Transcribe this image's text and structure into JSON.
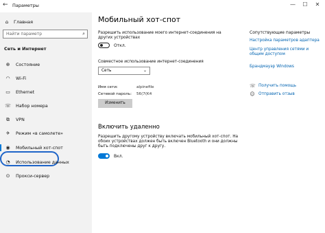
{
  "window": {
    "title": "Параметры",
    "back_icon": "back-arrow-icon",
    "minimize": "—",
    "maximize": "☐",
    "close": "✕"
  },
  "sidebar": {
    "home_label": "Главная",
    "search_placeholder": "Найти параметр",
    "section_title": "Сеть и Интернет",
    "items": [
      {
        "label": "Состояние",
        "icon": "status-icon",
        "glyph": "⊕"
      },
      {
        "label": "Wi-Fi",
        "icon": "wifi-icon",
        "glyph": "◠"
      },
      {
        "label": "Ethernet",
        "icon": "ethernet-icon",
        "glyph": "▭"
      },
      {
        "label": "Набор номера",
        "icon": "dialup-icon",
        "glyph": "☏"
      },
      {
        "label": "VPN",
        "icon": "vpn-icon",
        "glyph": "⧉"
      },
      {
        "label": "Режим «в самолете»",
        "icon": "airplane-icon",
        "glyph": "✈"
      },
      {
        "label": "Мобильный хот-спот",
        "icon": "hotspot-icon",
        "glyph": "◉"
      },
      {
        "label": "Использование данных",
        "icon": "data-usage-icon",
        "glyph": "◔"
      },
      {
        "label": "Прокси-сервер",
        "icon": "proxy-icon",
        "glyph": "⊙"
      }
    ],
    "selected_index": 6
  },
  "main": {
    "title": "Мобильный хот-спот",
    "share_desc": "Разрешить использование моего интернет-соединения на других устройствах",
    "share_toggle": "Откл.",
    "share_from_label": "Совместное использование интернет-соединения",
    "share_from_value": "Сеть",
    "name_label": "Имя сети:",
    "name_value": "alpinefile",
    "password_label": "Сетевой пароль:",
    "password_value": "56(7(K4",
    "change_button": "Изменить",
    "remote_title": "Включить удаленно",
    "remote_desc": "Разрешить другому устройству включать мобильный хот-спот. На обоих устройствах должен быть включен Bluetooth и они должны быть подключены друг к другу.",
    "remote_toggle": "Вкл."
  },
  "related": {
    "title": "Сопутствующие параметры",
    "links": [
      "Настройка параметров адаптера",
      "Центр управления сетями и общим доступом",
      "Брандмауэр Windows"
    ],
    "help": "Получить помощь",
    "feedback": "Отправить отзыв"
  },
  "colors": {
    "accent": "#0078d7",
    "link": "#0063b1",
    "sidebar_bg": "#f2f2f2",
    "highlight": "#1e64c8"
  }
}
